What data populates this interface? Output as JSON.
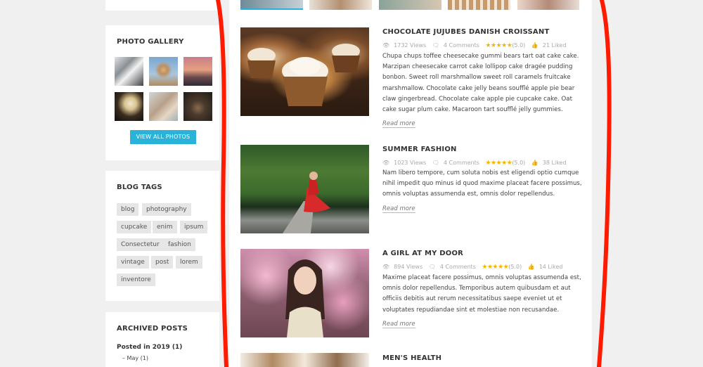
{
  "sidebar": {
    "gallery": {
      "title": "PHOTO GALLERY",
      "button": "VIEW ALL PHOTOS"
    },
    "tags": {
      "title": "BLOG TAGS",
      "items": [
        "blog",
        "photography",
        "cupcake",
        "enim",
        "ipsum",
        "Consectetur",
        "fashion",
        "vintage",
        "post",
        "lorem",
        "inventore"
      ]
    },
    "archive": {
      "title": "ARCHIVED POSTS",
      "year": "Posted in 2019 (1)",
      "month": "– May (1)"
    }
  },
  "posts": [
    {
      "title": "CHOCOLATE JUJUBES DANISH CROISSANT",
      "views": "1732 Views",
      "comments": "4 Comments",
      "stars": "★★★★★",
      "rating": "(5.0)",
      "likes": "21 Liked",
      "excerpt": "Chupa chups toffee cheesecake gummi bears tart oat cake cake. Marzipan cheesecake carrot cake lollipop cake dragée pudding bonbon. Sweet roll marshmallow sweet roll caramels fruitcake marshmallow. Chocolate cake jelly beans soufflé apple pie bear claw gingerbread. Chocolate cake apple pie cupcake cake. Oat cake sugar plum cake. Macaroon tart soufflé jelly gummies.",
      "read_more": "Read more"
    },
    {
      "title": "SUMMER FASHION",
      "views": "1023 Views",
      "comments": "4 Comments",
      "stars": "★★★★★",
      "rating": "(5.0)",
      "likes": "38 Liked",
      "excerpt": "Nam libero tempore, cum soluta nobis est eligendi optio cumque nihil impedit quo minus id quod maxime placeat facere possimus, omnis voluptas assumenda est, omnis dolor repellendus.",
      "read_more": "Read more"
    },
    {
      "title": "A GIRL AT MY DOOR",
      "views": "894 Views",
      "comments": "4 Comments",
      "stars": "★★★★★",
      "rating": "(5.0)",
      "likes": "14 Liked",
      "excerpt": "Maxime placeat facere possimus, omnis voluptas assumenda est, omnis dolor repellendus. Temporibus autem quibusdam et aut officiis debitis aut rerum necessitatibus saepe eveniet ut et voluptates repudiandae sint et molestiae non recusandae.",
      "read_more": "Read more"
    },
    {
      "title": "MEN'S HEALTH"
    }
  ],
  "colors": {
    "accent": "#2ab3d8",
    "star": "#f4b400",
    "marker": "#ff1a00"
  }
}
